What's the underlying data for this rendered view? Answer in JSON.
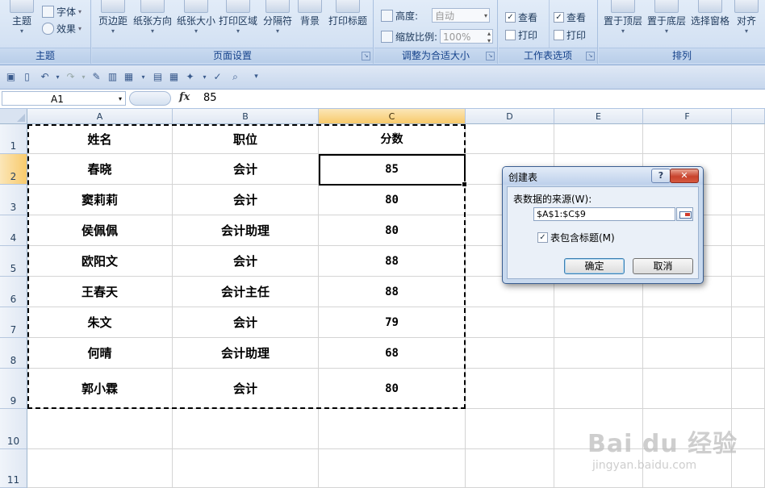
{
  "ribbon": {
    "groups": {
      "theme": {
        "label": "主题",
        "buttons": {
          "themes": "主题"
        },
        "small": {
          "fonts": "字体",
          "effects": "效果"
        }
      },
      "page_setup": {
        "label": "页面设置",
        "buttons": {
          "margins": "页边距",
          "orientation": "纸张方向",
          "size": "纸张大小",
          "print_area": "打印区域",
          "breaks": "分隔符",
          "background": "背景",
          "print_titles": "打印标题"
        }
      },
      "scale": {
        "label": "调整为合适大小",
        "height_label": "高度:",
        "height_value": "自动",
        "scale_label": "缩放比例:",
        "scale_value": "100%"
      },
      "sheet_options": {
        "label": "工作表选项",
        "view": "查看",
        "print": "打印"
      },
      "arrange": {
        "label": "排列",
        "buttons": {
          "bring_front": "置于顶层",
          "send_back": "置于底层",
          "selection_pane": "选择窗格",
          "align": "对齐"
        }
      }
    }
  },
  "formula_bar": {
    "name_box": "A1",
    "fx": "fx",
    "value": "85"
  },
  "sheet": {
    "columns": [
      "A",
      "B",
      "C",
      "D",
      "E",
      "F"
    ],
    "rows": [
      "1",
      "2",
      "3",
      "4",
      "5",
      "6",
      "7",
      "8",
      "9",
      "10",
      "11"
    ],
    "cells": [
      [
        "姓名",
        "职位",
        "分数"
      ],
      [
        "春晓",
        "会计",
        "85"
      ],
      [
        "窦莉莉",
        "会计",
        "80"
      ],
      [
        "侯佩佩",
        "会计助理",
        "80"
      ],
      [
        "欧阳文",
        "会计",
        "88"
      ],
      [
        "王春天",
        "会计主任",
        "88"
      ],
      [
        "朱文",
        "会计",
        "79"
      ],
      [
        "何晴",
        "会计助理",
        "68"
      ],
      [
        "郭小霖",
        "会计",
        "80"
      ]
    ]
  },
  "dialog": {
    "title": "创建表",
    "help": "?",
    "close": "✕",
    "source_label": "表数据的来源(W):",
    "source_value": "$A$1:$C$9",
    "has_headers": "表包含标题(M)",
    "has_headers_checked": true,
    "ok": "确定",
    "cancel": "取消"
  },
  "watermark": {
    "brand": "Bai du 经验",
    "url": "jingyan.baidu.com"
  }
}
